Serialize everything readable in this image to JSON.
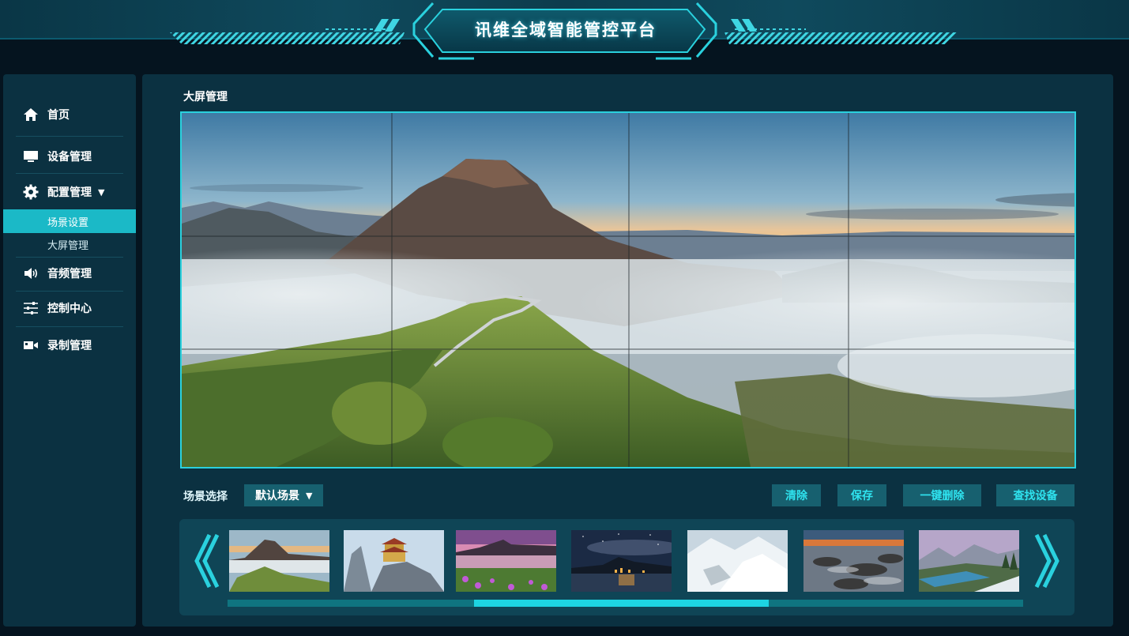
{
  "app": {
    "title": "讯维全域智能管控平台"
  },
  "sidebar": {
    "items": [
      {
        "label": "首页",
        "icon": "home-icon"
      },
      {
        "label": "设备管理",
        "icon": "monitor-icon"
      },
      {
        "label": "配置管理",
        "icon": "gear-icon",
        "expanded": true,
        "children": [
          {
            "label": "场景设置",
            "active": true
          },
          {
            "label": "大屏管理"
          }
        ]
      },
      {
        "label": "音频管理",
        "icon": "speaker-icon"
      },
      {
        "label": "控制中心",
        "icon": "sliders-icon"
      },
      {
        "label": "录制管理",
        "icon": "video-camera-icon"
      }
    ]
  },
  "main": {
    "title": "大屏管理",
    "video_wall": {
      "columns": 4,
      "rows": 3
    },
    "scene": {
      "label": "场景选择",
      "selected": "默认场景"
    },
    "buttons": {
      "clear": "清除",
      "save": "保存",
      "delete_all": "一键删除",
      "find_device": "查找设备"
    },
    "thumbnails": [
      "mountain-fog",
      "mountain-temple",
      "lake-sunset-flowers",
      "night-starry-harbor",
      "snow-mountain",
      "rocky-coast-sunset",
      "alpine-lake"
    ],
    "scroll": {
      "position": 0.31,
      "visible_fraction": 0.37
    }
  },
  "colors": {
    "accent": "#2ad1de",
    "panel": "#0b3141",
    "active": "#1bb9c7",
    "button": "#17606f"
  }
}
